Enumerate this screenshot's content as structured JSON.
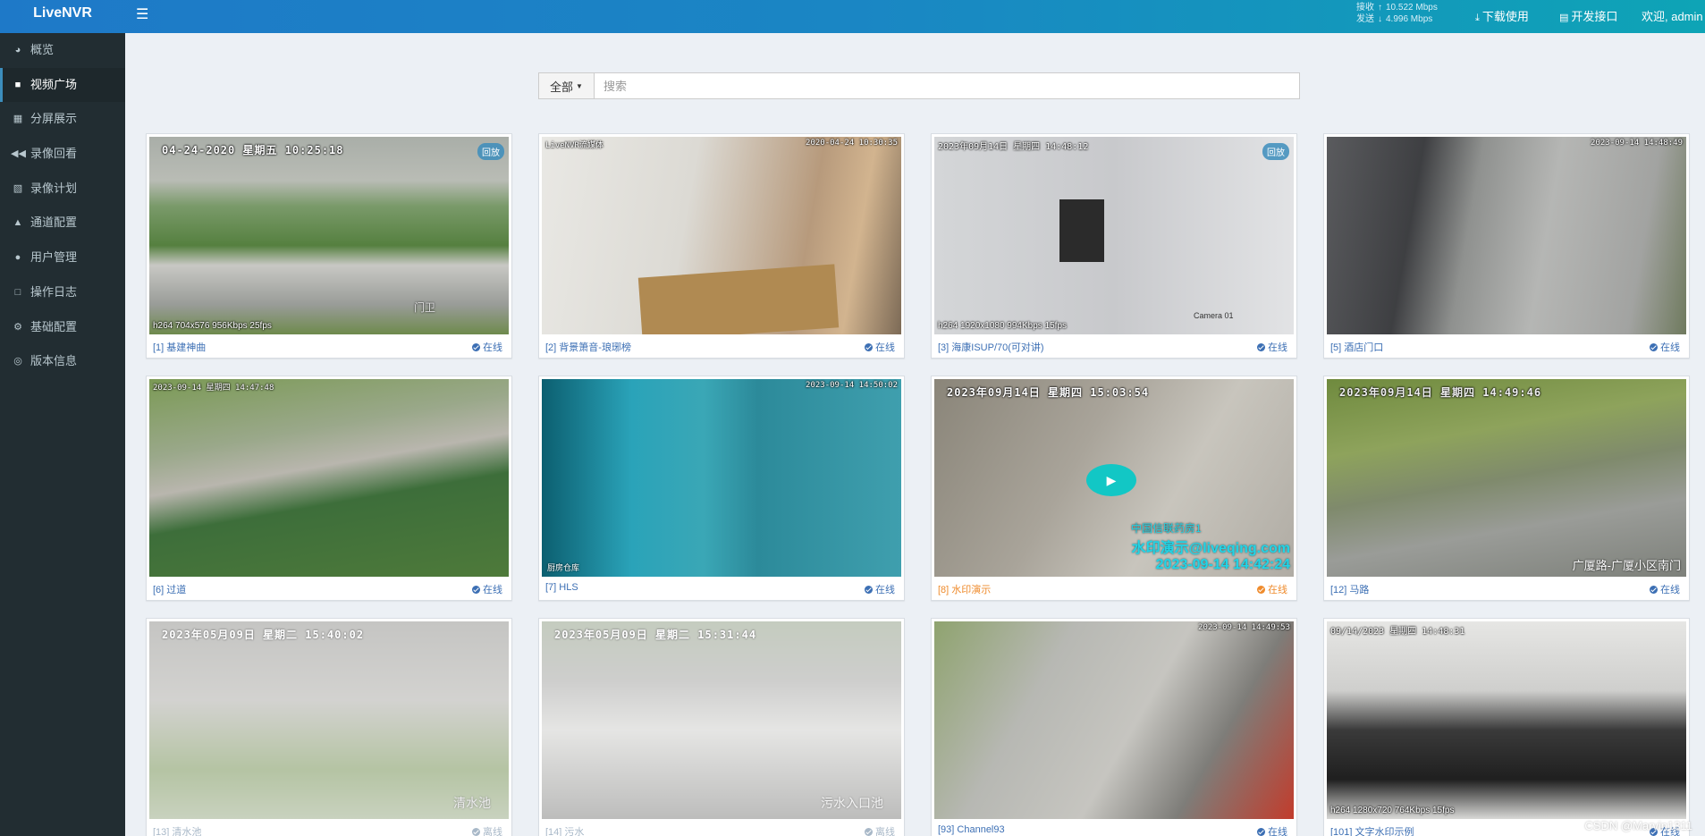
{
  "header": {
    "logo": "LiveNVR",
    "rx_label": "接收",
    "rx_value": "10.522 Mbps",
    "tx_label": "发送",
    "tx_value": "4.996 Mbps",
    "download_label": "下载使用",
    "api_label": "开发接口",
    "welcome": "欢迎, admin"
  },
  "sidebar": {
    "items": [
      {
        "label": "概览",
        "icon": "dashboard-icon"
      },
      {
        "label": "视频广场",
        "icon": "video-camera-icon",
        "active": true
      },
      {
        "label": "分屏展示",
        "icon": "grid-icon"
      },
      {
        "label": "录像回看",
        "icon": "rewind-icon"
      },
      {
        "label": "录像计划",
        "icon": "calendar-icon"
      },
      {
        "label": "通道配置",
        "icon": "channel-icon"
      },
      {
        "label": "用户管理",
        "icon": "users-icon"
      },
      {
        "label": "操作日志",
        "icon": "document-icon"
      },
      {
        "label": "基础配置",
        "icon": "gears-icon"
      },
      {
        "label": "版本信息",
        "icon": "globe-icon"
      }
    ]
  },
  "search": {
    "filter_label": "全部",
    "placeholder": "搜索",
    "value": ""
  },
  "cards": [
    {
      "name": "[1] 基建神曲",
      "status": "在线",
      "osd": "04-24-2020 星期五 10:25:18",
      "badge": "回放",
      "codec": "h264 704x576 956Kbps 25fps",
      "extra": "门卫"
    },
    {
      "name": "[2] 背景箫音-琅琊榜",
      "status": "在线",
      "osd_left": "LiveNVR流媒体",
      "osd_right": "2020-04-24 10:30:35"
    },
    {
      "name": "[3] 海康ISUP/70(可对讲)",
      "status": "在线",
      "osd": "2023年09月14日 星期四 14:48:12",
      "badge": "回放",
      "codec": "h264 1920x1080 994Kbps 15fps",
      "extra": "Camera 01"
    },
    {
      "name": "[5] 酒店门口",
      "status": "在线",
      "osd_right": "2023-09-14 14:48:49"
    },
    {
      "name": "[6] 过道",
      "status": "在线",
      "osd": "2023-09-14 星期四 14:47:48"
    },
    {
      "name": "[7] HLS",
      "status": "在线",
      "osd_right": "2023-09-14 14:50:02",
      "extra": "厨房仓库"
    },
    {
      "name": "[8] 水印演示",
      "status": "在线",
      "osd": "2023年09月14日 星期四 15:03:54",
      "wm1": "水印演示@liveqing.com",
      "wm2": "2023-09-14 14:42:24",
      "extra": "中国信联药房1"
    },
    {
      "name": "[12] 马路",
      "status": "在线",
      "osd": "2023年09月14日 星期四 14:49:46",
      "extra": "广厦路-广厦小区南门"
    },
    {
      "name": "[13] 清水池",
      "status": "离线",
      "osd": "2023年05月09日 星期二 15:40:02",
      "extra": "清水池"
    },
    {
      "name": "[14] 污水",
      "status": "离线",
      "osd": "2023年05月09日 星期二 15:31:44",
      "extra": "污水入口池"
    },
    {
      "name": "[93] Channel93",
      "status": "在线",
      "osd_right": "2023-09-14 14:49:53"
    },
    {
      "name": "[101] 文字水印示例",
      "status": "在线",
      "osd": "09/14/2023 星期四 14:48:31",
      "codec": "h264 1280x720 764Kbps 15fps"
    }
  ],
  "footer_watermark": "CSDN @Marvin1311"
}
